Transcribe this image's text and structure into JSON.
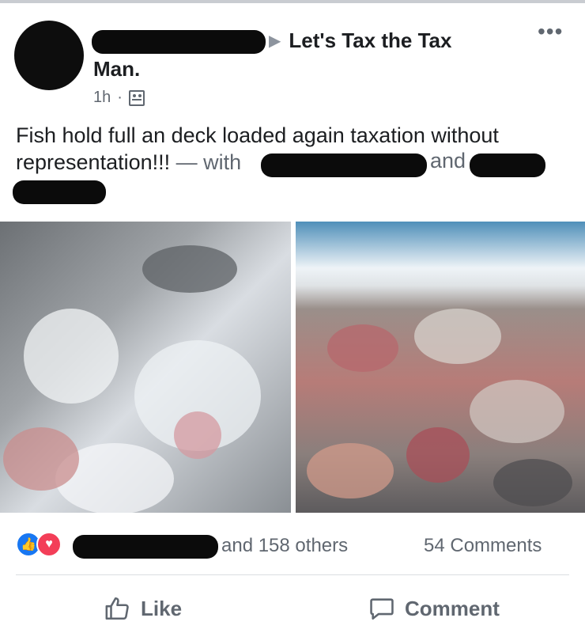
{
  "post": {
    "group_name_line1": "Let's Tax the Tax",
    "group_name_line2": "Man.",
    "timestamp": "1h",
    "separator": "·",
    "audience_icon": "group-audience-icon",
    "more_icon": "•••",
    "text_main": "Fish hold full an deck loaded again taxation without representation!!!",
    "text_with": " — with",
    "text_and": "and"
  },
  "images": {
    "left_icon": "sharks-on-ice-photo",
    "right_icon": "boat-deck-shark-carcasses-photo"
  },
  "stats": {
    "reaction_icons": [
      "like-icon",
      "love-icon"
    ],
    "like_glyph": "👍",
    "love_glyph": "♥",
    "reactions_text": "and 158 others",
    "comments_text": "54 Comments"
  },
  "actions": {
    "like_label": "Like",
    "comment_label": "Comment"
  },
  "colors": {
    "like_blue": "#1877f2",
    "love_red": "#f33e58",
    "secondary_text": "#606770"
  }
}
